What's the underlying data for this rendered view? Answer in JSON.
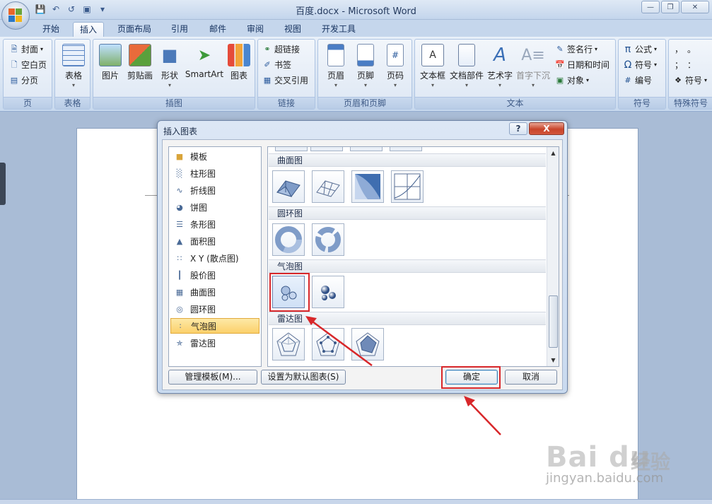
{
  "window": {
    "title": "百度.docx - Microsoft Word"
  },
  "tabs": [
    "开始",
    "插入",
    "页面布局",
    "引用",
    "邮件",
    "审阅",
    "视图",
    "开发工具"
  ],
  "active_tab": "插入",
  "ribbon": {
    "page_group": {
      "label": "页",
      "items": [
        "封面",
        "空白页",
        "分页"
      ]
    },
    "table_group": {
      "label": "表格",
      "items": [
        "表格"
      ]
    },
    "illustration_group": {
      "label": "插图",
      "items": [
        "图片",
        "剪贴画",
        "形状",
        "SmartArt",
        "图表"
      ]
    },
    "link_group": {
      "label": "链接",
      "items": [
        "超链接",
        "书签",
        "交叉引用"
      ]
    },
    "header_footer_group": {
      "label": "页眉和页脚",
      "items": [
        "页眉",
        "页脚",
        "页码"
      ]
    },
    "text_group": {
      "label": "文本",
      "items": [
        "文本框",
        "文档部件",
        "艺术字",
        "首字下沉",
        "签名行",
        "日期和时间",
        "对象"
      ]
    },
    "symbol_group": {
      "label": "符号",
      "items": [
        "公式",
        "符号",
        "编号"
      ]
    },
    "special_group": {
      "label": "特殊符号",
      "items": [
        "符号"
      ]
    }
  },
  "dialog": {
    "title": "插入图表",
    "help_label": "?",
    "close_label": "X",
    "categories": [
      "模板",
      "柱形图",
      "折线图",
      "饼图",
      "条形图",
      "面积图",
      "X Y (散点图)",
      "股价图",
      "曲面图",
      "圆环图",
      "气泡图",
      "雷达图"
    ],
    "selected_category": "气泡图",
    "sections": [
      "曲面图",
      "圆环图",
      "气泡图",
      "雷达图"
    ],
    "buttons": {
      "manage": "管理模板(M)...",
      "set_default": "设置为默认图表(S)",
      "ok": "确定",
      "cancel": "取消"
    }
  },
  "watermark": {
    "logo": "Bai du",
    "cn": "经验",
    "url": "jingyan.baidu.com"
  },
  "colors": {
    "highlight_red": "#d8272a",
    "accent": "#2a5a9c"
  }
}
